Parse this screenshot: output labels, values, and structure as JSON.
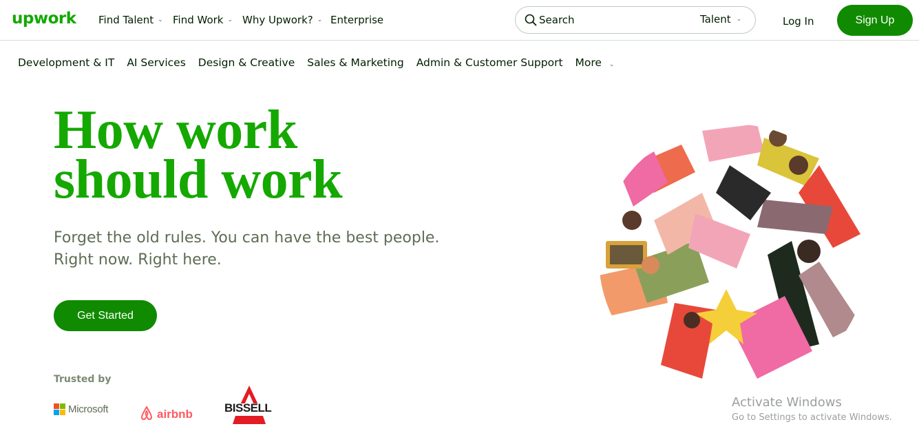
{
  "header": {
    "logo": "upwork",
    "nav": [
      {
        "label": "Find Talent",
        "has_chevron": true
      },
      {
        "label": "Find Work",
        "has_chevron": true
      },
      {
        "label": "Why Upwork?",
        "has_chevron": true
      },
      {
        "label": "Enterprise",
        "has_chevron": false
      }
    ],
    "search": {
      "placeholder": "Search",
      "scope": "Talent"
    },
    "login_label": "Log In",
    "signup_label": "Sign Up"
  },
  "categories": {
    "items": [
      "Development & IT",
      "AI Services",
      "Design & Creative",
      "Sales & Marketing",
      "Admin & Customer Support"
    ],
    "more_label": "More"
  },
  "hero": {
    "headline_line1": "How work",
    "headline_line2": "should work",
    "subtitle_line1": "Forget the old rules. You can have the best people.",
    "subtitle_line2": "Right now. Right here.",
    "cta_label": "Get Started"
  },
  "trusted": {
    "label": "Trusted by",
    "brands": {
      "microsoft": "Microsoft",
      "airbnb": "airbnb",
      "bissell": "BISSELL"
    }
  },
  "watermark": {
    "title": "Activate Windows",
    "subtitle": "Go to Settings to activate Windows."
  },
  "colors": {
    "brand_green": "#14a800",
    "button_green": "#108a00",
    "text_dark": "#001e00",
    "text_muted": "#5e6d55",
    "airbnb_red": "#ff5a5f",
    "bissell_red": "#e31b23"
  },
  "icons": {
    "search": "search-icon",
    "chevron": "chevron-down-icon"
  }
}
